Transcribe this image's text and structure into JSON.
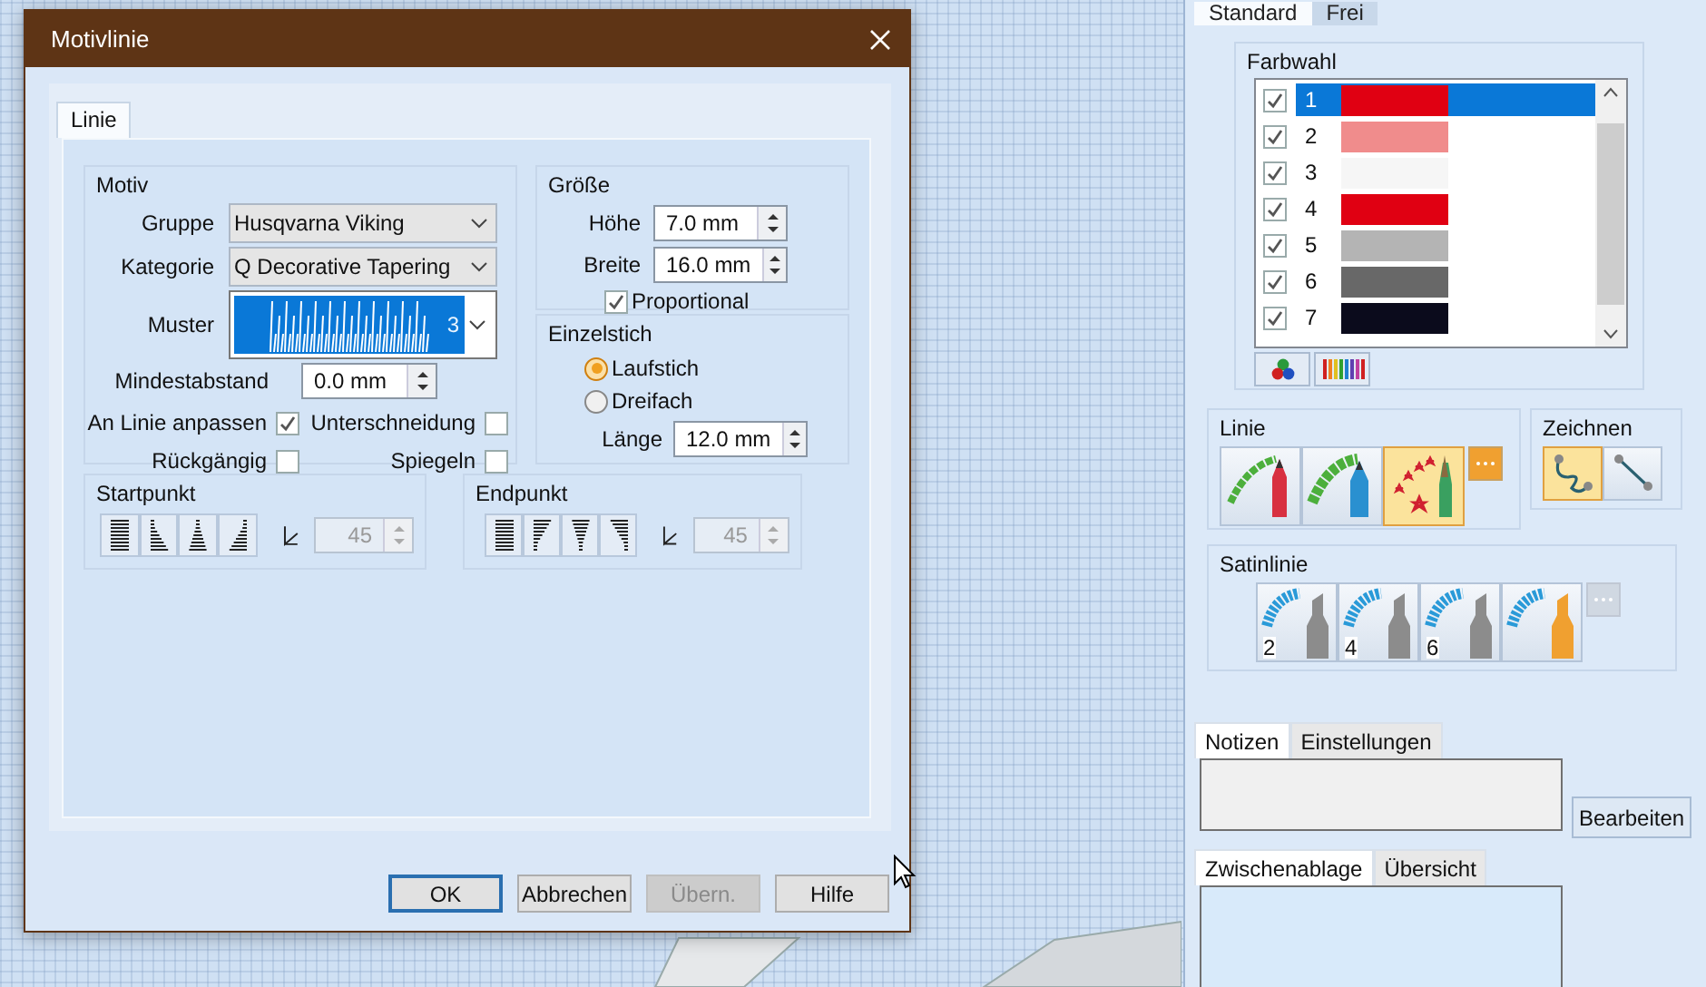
{
  "dialog": {
    "title": "Motivlinie",
    "tabs": [
      {
        "label": "Linie",
        "selected": true
      }
    ],
    "motiv": {
      "title": "Motiv",
      "fields": [
        {
          "label": "Gruppe",
          "value": "Husqvarna Viking"
        },
        {
          "label": "Kategorie",
          "value": "Q Decorative Tapering"
        }
      ],
      "muster": {
        "label": "Muster",
        "value": "3"
      },
      "mindestabstand": {
        "label": "Mindestabstand",
        "value": "0.0 mm"
      },
      "options": [
        {
          "label": "An Linie anpassen",
          "checked": true
        },
        {
          "label": "Unterschneidung",
          "checked": false
        },
        {
          "label": "Rückgängig",
          "checked": false
        },
        {
          "label": "Spiegeln",
          "checked": false
        }
      ]
    },
    "groesse": {
      "title": "Größe",
      "fields": [
        {
          "label": "Höhe",
          "value": "7.0 mm"
        },
        {
          "label": "Breite",
          "value": "16.0 mm"
        }
      ],
      "proportional": {
        "label": "Proportional",
        "checked": true
      }
    },
    "einzelstich": {
      "title": "Einzelstich",
      "radios": [
        {
          "label": "Laufstich",
          "selected": true
        },
        {
          "label": "Dreifach",
          "selected": false
        }
      ],
      "laenge": {
        "label": "Länge",
        "value": "12.0 mm"
      }
    },
    "ends": [
      {
        "title": "Startpunkt",
        "angle": "45",
        "disabled": true
      },
      {
        "title": "Endpunkt",
        "angle": "45",
        "disabled": true
      }
    ],
    "buttons": [
      {
        "label": "OK",
        "default": true,
        "disabled": false
      },
      {
        "label": "Abbrechen",
        "default": false,
        "disabled": false
      },
      {
        "label": "Übern.",
        "default": false,
        "disabled": true
      },
      {
        "label": "Hilfe",
        "default": false,
        "disabled": false
      }
    ]
  },
  "panel": {
    "tabs": [
      {
        "label": "Standard",
        "selected": true
      },
      {
        "label": "Frei",
        "selected": false
      }
    ],
    "farbwahl": {
      "title": "Farbwahl",
      "colors": [
        {
          "number": "1",
          "checked": true,
          "selected": true,
          "color": "#e00012"
        },
        {
          "number": "2",
          "checked": true,
          "selected": false,
          "color": "#f08c8c"
        },
        {
          "number": "3",
          "checked": true,
          "selected": false,
          "color": "#f6f6f6"
        },
        {
          "number": "4",
          "checked": true,
          "selected": false,
          "color": "#e00012"
        },
        {
          "number": "5",
          "checked": true,
          "selected": false,
          "color": "#b4b4b4"
        },
        {
          "number": "6",
          "checked": true,
          "selected": false,
          "color": "#686868"
        },
        {
          "number": "7",
          "checked": true,
          "selected": false,
          "color": "#0b0b1c"
        }
      ]
    },
    "linie": {
      "title": "Linie",
      "more_disabled": false,
      "tools": [
        {
          "kind": "red-pencil",
          "selected": false
        },
        {
          "kind": "blue-pencil",
          "selected": false
        },
        {
          "kind": "star-brush",
          "selected": true
        }
      ]
    },
    "zeichnen": {
      "title": "Zeichnen",
      "tools": [
        {
          "kind": "freehand",
          "selected": true
        },
        {
          "kind": "point-line",
          "selected": false
        }
      ]
    },
    "satinlinie": {
      "title": "Satinlinie",
      "more_disabled": true,
      "tools": [
        {
          "label": "2",
          "color": "#8c8c8c"
        },
        {
          "label": "4",
          "color": "#8c8c8c"
        },
        {
          "label": "6",
          "color": "#8c8c8c"
        },
        {
          "color": "#f0a030"
        }
      ]
    },
    "notes_tabs": [
      {
        "label": "Notizen",
        "selected": true
      },
      {
        "label": "Einstellungen",
        "selected": false
      }
    ],
    "edit_button": "Bearbeiten",
    "clip_tabs": [
      {
        "label": "Zwischenablage",
        "selected": true
      },
      {
        "label": "Übersicht",
        "selected": false
      }
    ]
  }
}
